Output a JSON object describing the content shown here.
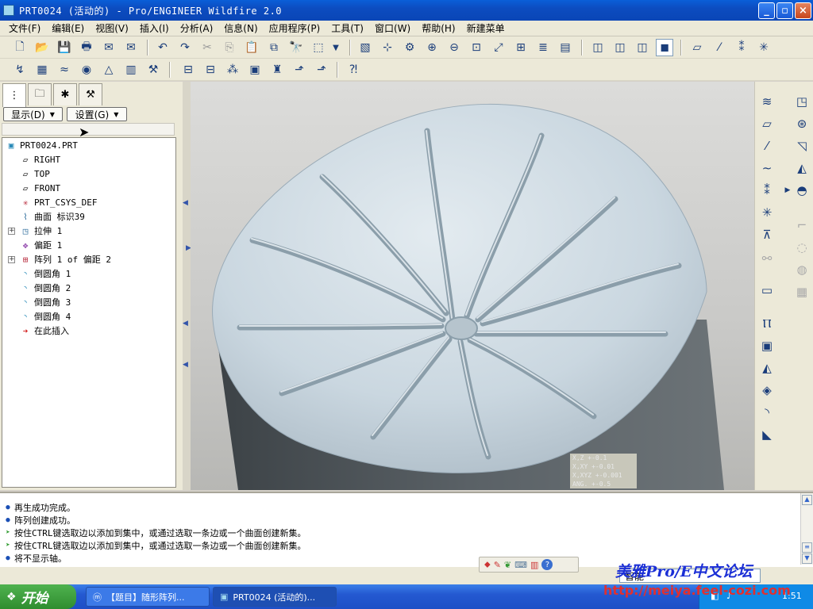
{
  "window": {
    "title": "PRT0024 (活动的) - Pro/ENGINEER Wildfire 2.0",
    "buttons": {
      "min": "_",
      "max": "▫",
      "close": "×"
    }
  },
  "menu": [
    "文件(F)",
    "编辑(E)",
    "视图(V)",
    "插入(I)",
    "分析(A)",
    "信息(N)",
    "应用程序(P)",
    "工具(T)",
    "窗口(W)",
    "帮助(H)",
    "新建菜单"
  ],
  "left_panel": {
    "show_button": "显示(D)",
    "settings_button": "设置(G)",
    "tree": [
      {
        "label": "PRT0024.PRT",
        "icon": "part-icon"
      },
      {
        "label": "RIGHT",
        "icon": "datum-plane-icon"
      },
      {
        "label": "TOP",
        "icon": "datum-plane-icon"
      },
      {
        "label": "FRONT",
        "icon": "datum-plane-icon"
      },
      {
        "label": "PRT_CSYS_DEF",
        "icon": "csys-icon"
      },
      {
        "label": "曲面 标识39",
        "icon": "surface-icon"
      },
      {
        "label": "拉伸 1",
        "icon": "extrude-icon"
      },
      {
        "label": "偏距 1",
        "icon": "offset-icon"
      },
      {
        "label": "阵列 1 of 偏距 2",
        "icon": "pattern-icon"
      },
      {
        "label": "倒圆角 1",
        "icon": "round-icon"
      },
      {
        "label": "倒圆角 2",
        "icon": "round-icon"
      },
      {
        "label": "倒圆角 3",
        "icon": "round-icon"
      },
      {
        "label": "倒圆角 4",
        "icon": "round-icon"
      },
      {
        "label": "在此插入",
        "icon": "insert-here-icon"
      }
    ]
  },
  "messages": [
    {
      "text": "再生成功完成。",
      "type": "info"
    },
    {
      "text": "阵列创建成功。",
      "type": "info"
    },
    {
      "text": "按住CTRL键选取边以添加到集中，或通过选取一条边或一个曲面创建新集。",
      "type": "prompt"
    },
    {
      "text": "按住CTRL键选取边以添加到集中，或通过选取一条边或一个曲面创建新集。",
      "type": "prompt"
    },
    {
      "text": "将不显示轴。",
      "type": "info"
    }
  ],
  "status": {
    "filter": "智能"
  },
  "coords": [
    "X,Z +-0.1",
    "X,XY +-0.01",
    "X,XYZ +-0.001",
    "ANG. +-0.5"
  ],
  "watermark": {
    "title": "美雅Pro/E中文论坛",
    "url": "http://meiya.feel-cozi.com"
  },
  "taskbar": {
    "start": "开始",
    "tasks": [
      "【题目】随形阵列...",
      "PRT0024 (活动的)..."
    ],
    "clock": "1:51"
  },
  "colors": {
    "title_bar": "#0a5fd8",
    "model_top": "#c9d6e0",
    "model_side": "#4d5458"
  }
}
